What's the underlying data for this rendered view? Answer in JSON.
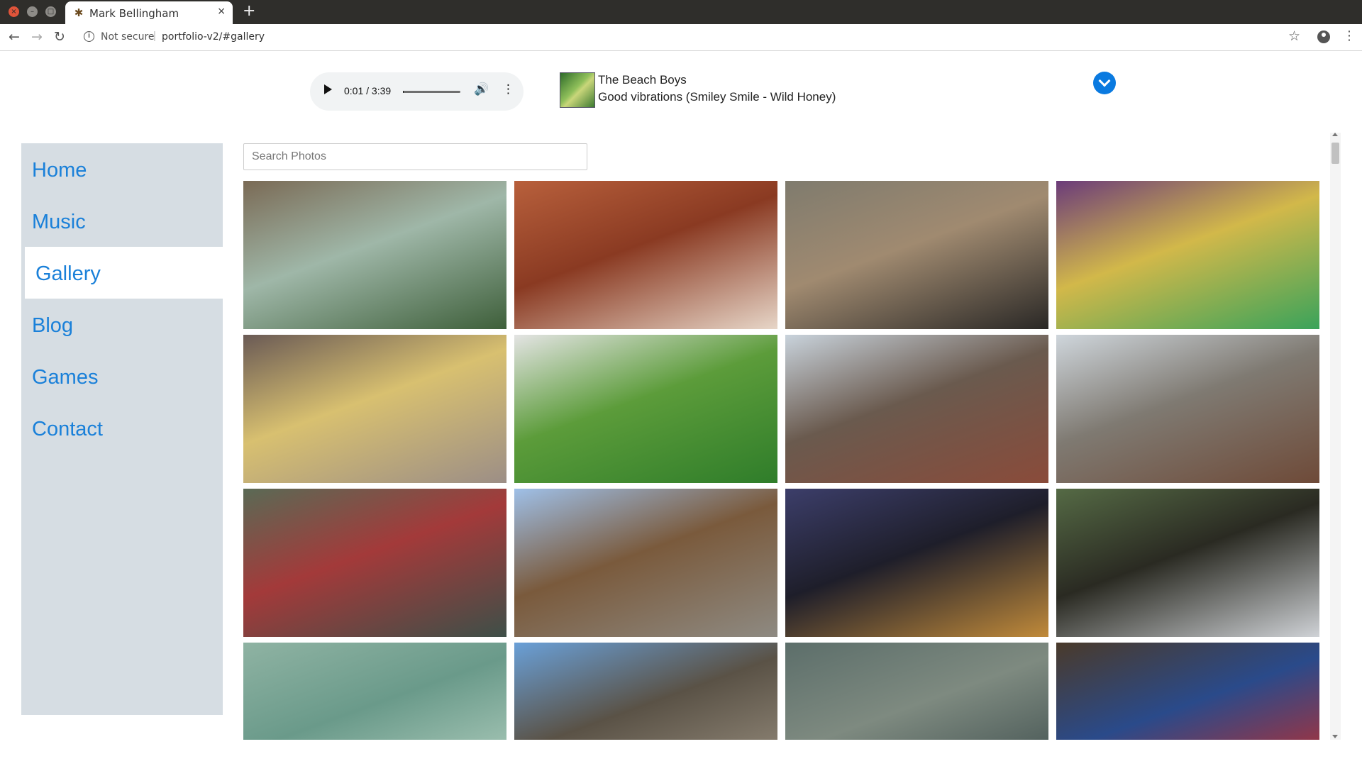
{
  "browser": {
    "tab_title": "Mark Bellingham",
    "tab_close": "×",
    "new_tab": "+",
    "security_label": "Not secure",
    "url": "portfolio-v2/#gallery"
  },
  "player": {
    "time": "0:01 / 3:39",
    "progress_fraction": 0.005,
    "artist": "The Beach Boys",
    "track": "Good vibrations (Smiley Smile - Wild Honey)"
  },
  "sidebar": {
    "items": [
      {
        "label": "Home"
      },
      {
        "label": "Music"
      },
      {
        "label": "Gallery"
      },
      {
        "label": "Blog"
      },
      {
        "label": "Games"
      },
      {
        "label": "Contact"
      }
    ],
    "active": "Gallery"
  },
  "search": {
    "placeholder": "Search Photos"
  },
  "gallery": {
    "photos": [
      {
        "name": "riverside-stilt-houses",
        "colors": [
          "#7a6a55",
          "#3e5f3a",
          "#9fb7a8"
        ]
      },
      {
        "name": "red-rock-hoodoos",
        "colors": [
          "#b8603c",
          "#e7d6c8",
          "#8a3a22"
        ]
      },
      {
        "name": "goats-on-hillside",
        "colors": [
          "#7f7b6e",
          "#2a2826",
          "#a08a70"
        ]
      },
      {
        "name": "colorful-parade-dancers",
        "colors": [
          "#6b3b7a",
          "#3aa35a",
          "#d2b84a"
        ]
      },
      {
        "name": "woman-making-offering",
        "colors": [
          "#6a5a55",
          "#9c8e86",
          "#d8c070"
        ]
      },
      {
        "name": "parrot-in-grass",
        "colors": [
          "#e4e4e4",
          "#2f7d2a",
          "#5c9c3a"
        ]
      },
      {
        "name": "moorish-red-building",
        "colors": [
          "#c9d3dc",
          "#8a4b3a",
          "#6a5a4e"
        ]
      },
      {
        "name": "chinese-gate-tower",
        "colors": [
          "#cfd6dc",
          "#6e4a38",
          "#7f7a72"
        ]
      },
      {
        "name": "lakeside-pavilions",
        "colors": [
          "#5a6a55",
          "#3e4f48",
          "#a33a3a"
        ]
      },
      {
        "name": "stepped-pyramid",
        "colors": [
          "#9fc0e8",
          "#8e8a82",
          "#7a5a3c"
        ]
      },
      {
        "name": "plaza-at-night",
        "colors": [
          "#3c3e6a",
          "#c08a3a",
          "#1e1e2a"
        ]
      },
      {
        "name": "hornbill-in-tree",
        "colors": [
          "#556a45",
          "#cfd2d6",
          "#2a2a22"
        ]
      },
      {
        "name": "shallow-water",
        "colors": [
          "#8fb3a3",
          "#b7d3c3",
          "#6a9a8a"
        ]
      },
      {
        "name": "carved-stone-temple",
        "colors": [
          "#6aa0d8",
          "#9e9484",
          "#5a5246"
        ]
      },
      {
        "name": "street-market-stall",
        "colors": [
          "#5c6e6a",
          "#3a4a4a",
          "#7e8a80"
        ]
      },
      {
        "name": "scarlet-macaws",
        "colors": [
          "#4a3a2a",
          "#d02a22",
          "#2a4a8a"
        ]
      }
    ]
  }
}
